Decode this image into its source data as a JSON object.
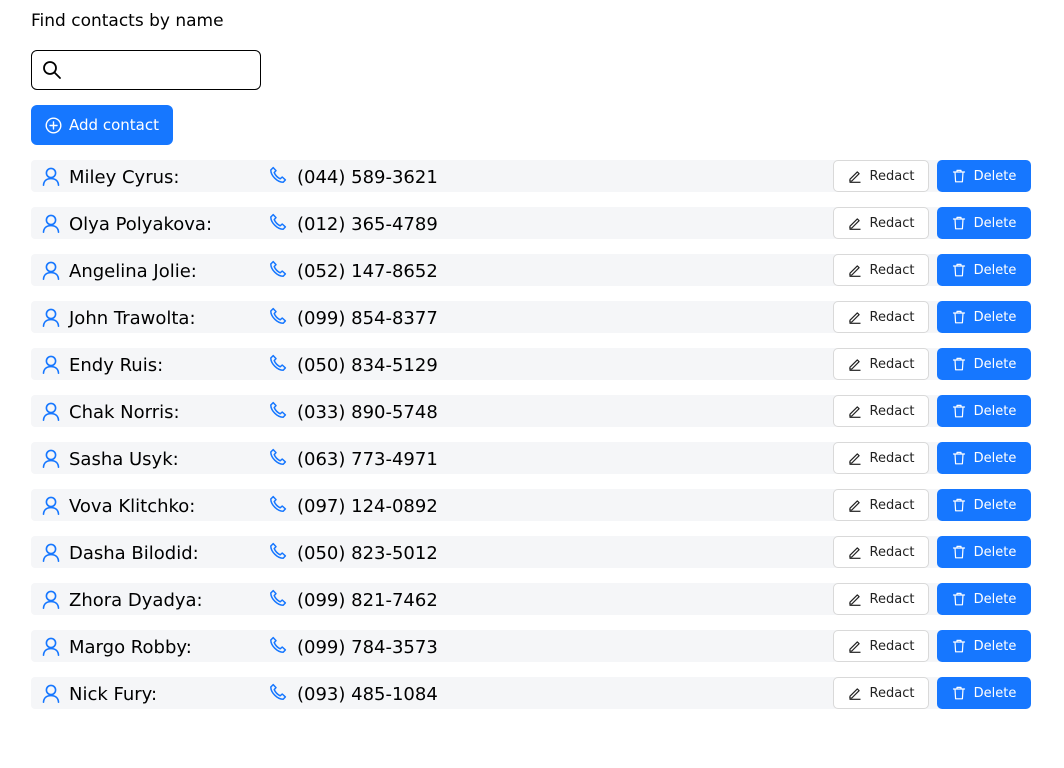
{
  "title": "Find contacts by name",
  "search": {
    "placeholder": "",
    "value": "",
    "icon": "search-icon"
  },
  "add_button": {
    "label": "Add contact",
    "icon": "plus-circle-icon"
  },
  "row_actions": {
    "redact_label": "Redact",
    "delete_label": "Delete"
  },
  "colors": {
    "accent": "#1677ff",
    "row_bg": "#f5f6f8"
  },
  "contacts": [
    {
      "name": "Miley Cyrus:",
      "phone": "(044) 589-3621"
    },
    {
      "name": "Olya Polyakova:",
      "phone": "(012) 365-4789"
    },
    {
      "name": "Angelina Jolie:",
      "phone": "(052) 147-8652"
    },
    {
      "name": "John Trawolta:",
      "phone": "(099) 854-8377"
    },
    {
      "name": "Endy Ruis:",
      "phone": "(050) 834-5129"
    },
    {
      "name": "Chak Norris:",
      "phone": "(033) 890-5748"
    },
    {
      "name": "Sasha Usyk:",
      "phone": "(063) 773-4971"
    },
    {
      "name": "Vova Klitchko:",
      "phone": "(097) 124-0892"
    },
    {
      "name": "Dasha Bilodid:",
      "phone": "(050) 823-5012"
    },
    {
      "name": "Zhora Dyadya:",
      "phone": "(099) 821-7462"
    },
    {
      "name": "Margo Robby:",
      "phone": "(099) 784-3573"
    },
    {
      "name": "Nick Fury:",
      "phone": "(093) 485-1084"
    }
  ]
}
